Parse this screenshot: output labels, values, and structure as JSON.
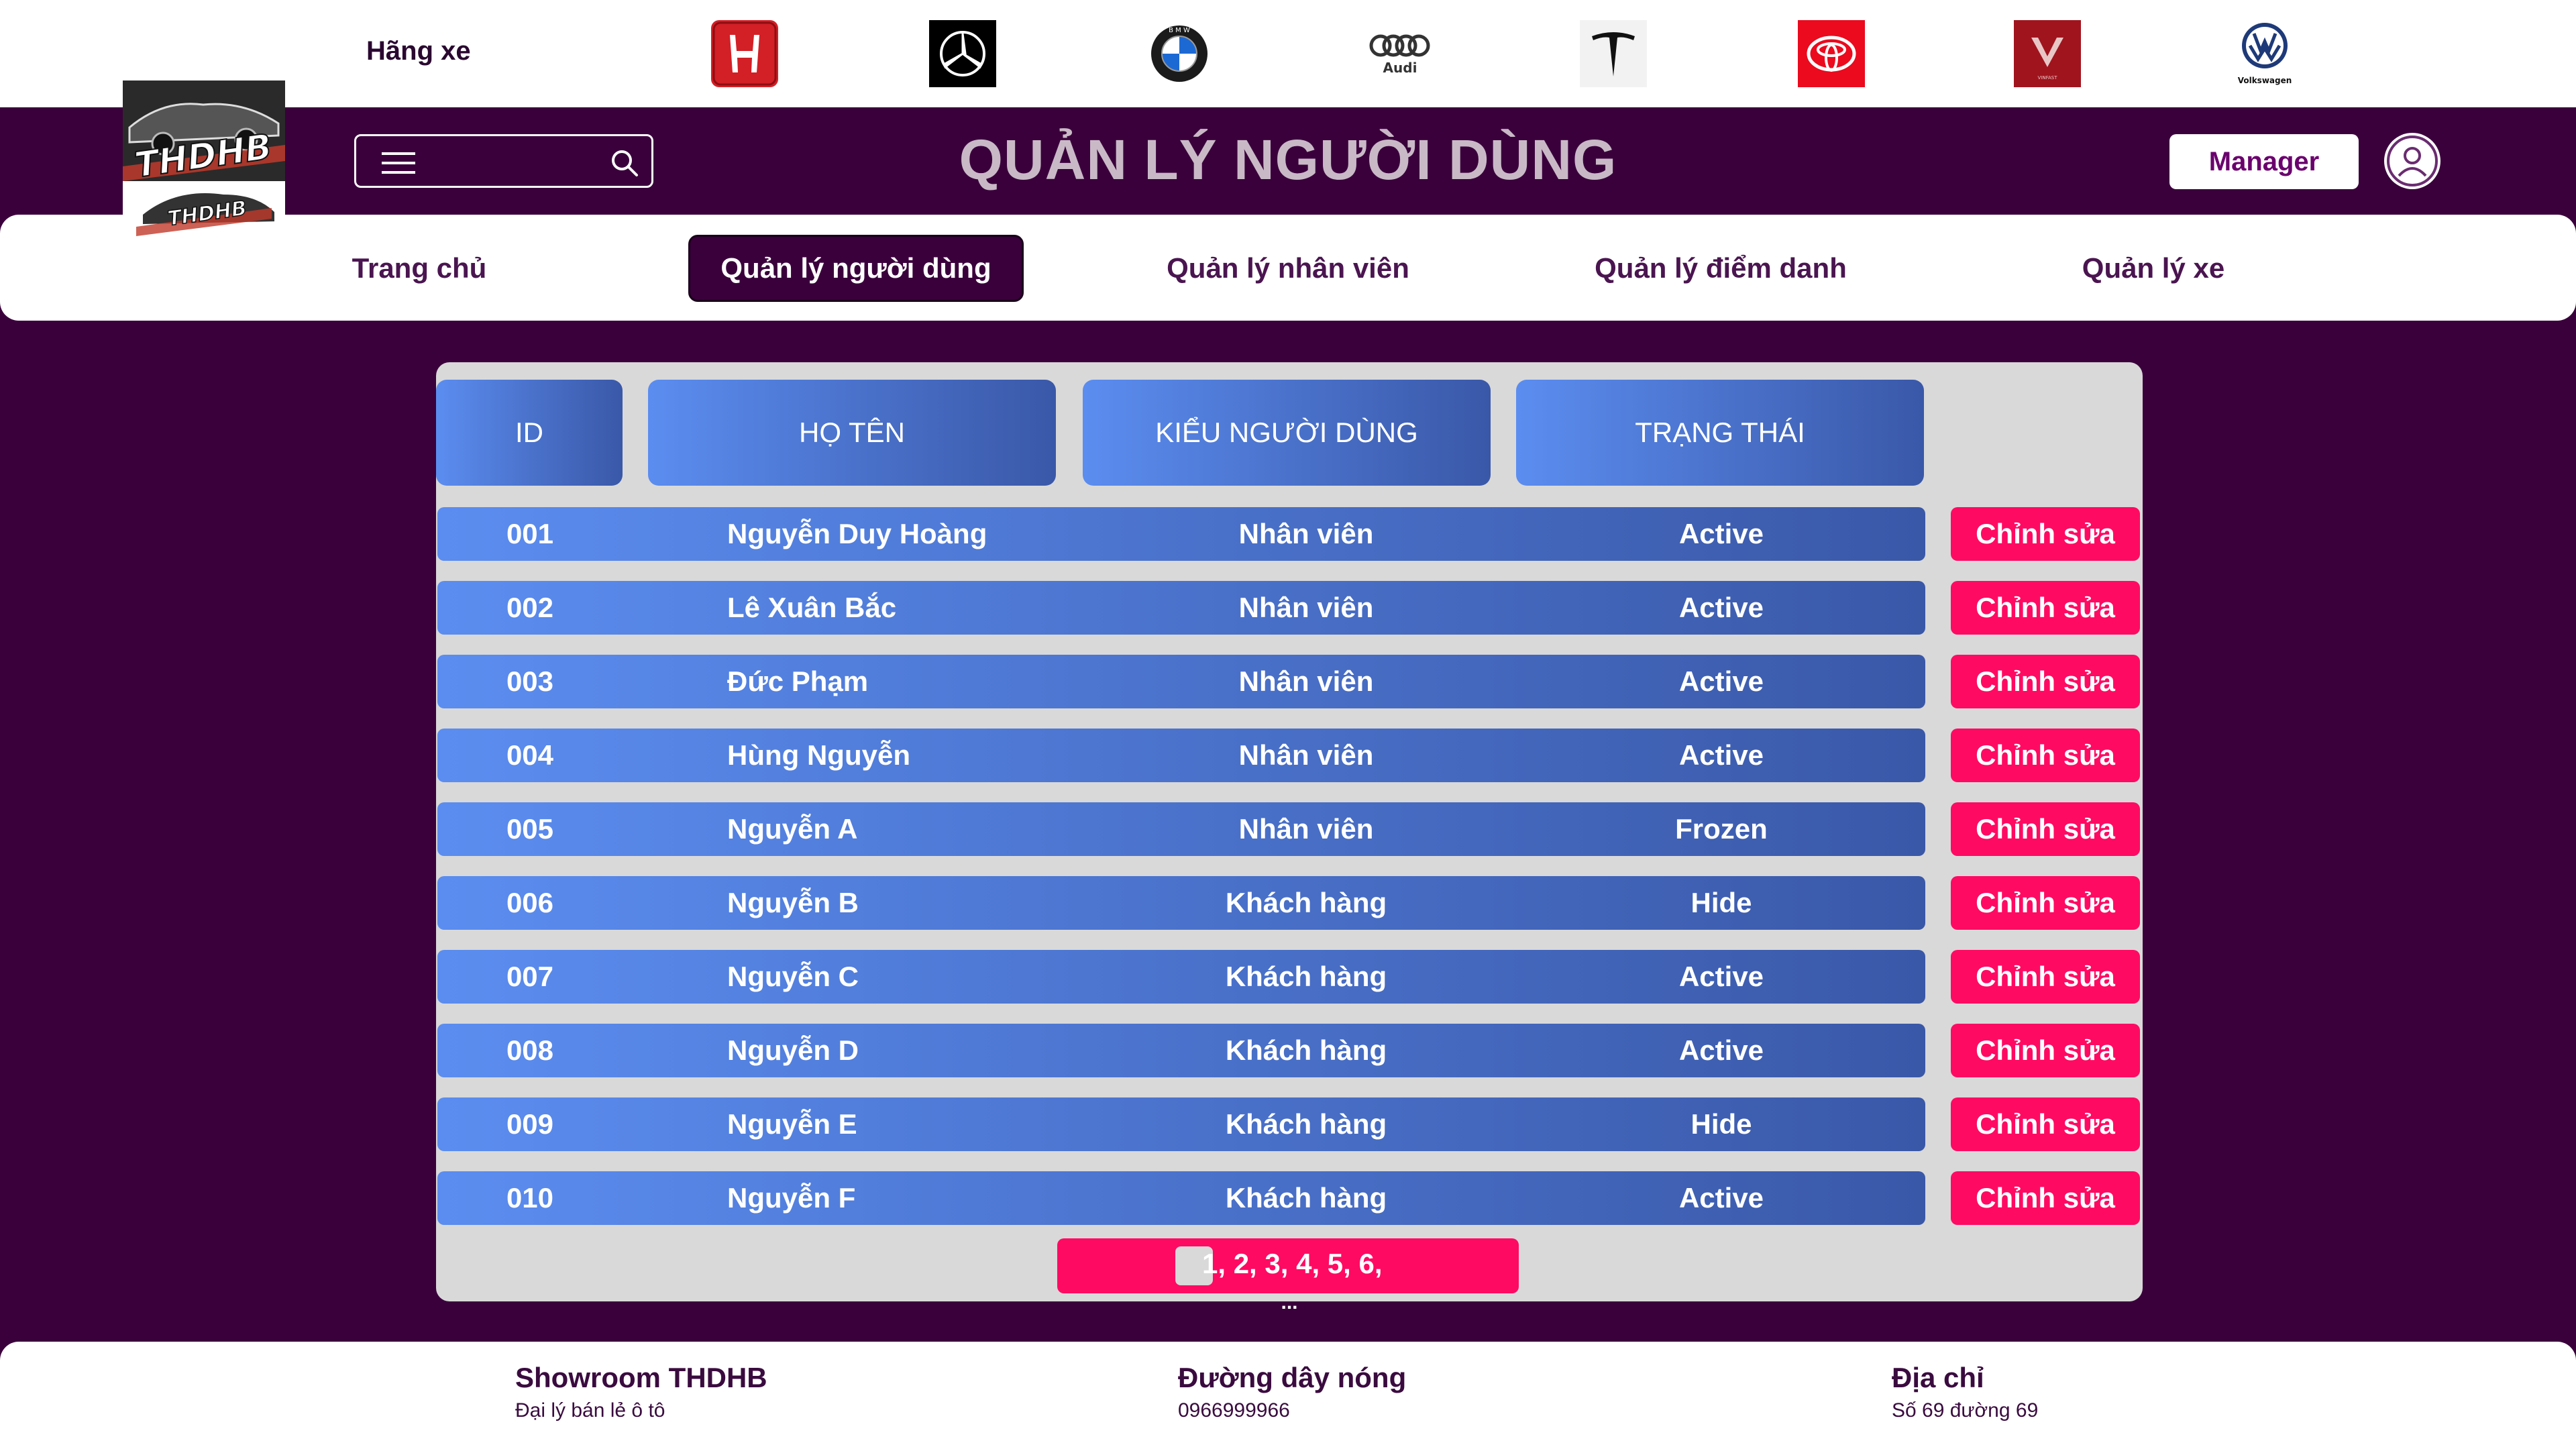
{
  "brands": {
    "label": "Hãng xe",
    "items": [
      {
        "name": "honda-logo",
        "color": "#d31f26"
      },
      {
        "name": "mercedes-logo",
        "color": "#000000"
      },
      {
        "name": "bmw-logo",
        "color": "#1c69d4"
      },
      {
        "name": "audi-logo",
        "color": "#000000",
        "text": "Audi"
      },
      {
        "name": "tesla-logo",
        "color": "#000000"
      },
      {
        "name": "toyota-logo",
        "color": "#eb0a1e"
      },
      {
        "name": "vinfast-logo",
        "color": "#b71c1c",
        "text": "VINFAST"
      },
      {
        "name": "volkswagen-logo",
        "color": "#1e3a78",
        "text": "Volkswagen"
      }
    ]
  },
  "logo": {
    "text": "THDHB"
  },
  "header": {
    "title": "QUẢN LÝ NGƯỜI DÙNG",
    "manager_label": "Manager"
  },
  "nav": {
    "items": [
      {
        "label": "Trang chủ",
        "active": false
      },
      {
        "label": "Quản lý người dùng",
        "active": true
      },
      {
        "label": "Quản lý nhân viên",
        "active": false
      },
      {
        "label": "Quản lý điểm danh",
        "active": false
      },
      {
        "label": "Quản lý xe",
        "active": false
      }
    ]
  },
  "table": {
    "headers": [
      "ID",
      "HỌ TÊN",
      "KIỂU NGƯỜI DÙNG",
      "TRẠNG THÁI"
    ],
    "edit_label": "Chỉnh sửa",
    "rows": [
      {
        "id": "001",
        "name": "Nguyễn Duy Hoàng",
        "type": "Nhân viên",
        "status": "Active"
      },
      {
        "id": "002",
        "name": "Lê Xuân Bắc",
        "type": "Nhân viên",
        "status": "Active"
      },
      {
        "id": "003",
        "name": "Đức Phạm",
        "type": "Nhân viên",
        "status": "Active"
      },
      {
        "id": "004",
        "name": "Hùng Nguyễn",
        "type": "Nhân viên",
        "status": "Active"
      },
      {
        "id": "005",
        "name": "Nguyễn A",
        "type": "Nhân viên",
        "status": "Frozen"
      },
      {
        "id": "006",
        "name": "Nguyễn B",
        "type": "Khách hàng",
        "status": "Hide"
      },
      {
        "id": "007",
        "name": "Nguyễn C",
        "type": "Khách hàng",
        "status": "Active"
      },
      {
        "id": "008",
        "name": "Nguyễn D",
        "type": "Khách hàng",
        "status": "Active"
      },
      {
        "id": "009",
        "name": "Nguyễn E",
        "type": "Khách hàng",
        "status": "Hide"
      },
      {
        "id": "010",
        "name": "Nguyễn F",
        "type": "Khách hàng",
        "status": "Active"
      }
    ]
  },
  "pagination": {
    "text": "1, 2, 3, 4, 5, 6,",
    "more": "...",
    "current": "1"
  },
  "footer": {
    "showroom_title": "Showroom THDHB",
    "showroom_sub": "Đại lý bán lẻ ô tô",
    "hotline_title": "Đường dây nóng",
    "hotline_value": "0966999966",
    "address_title": "Địa chỉ",
    "address_value": "Số 69 đường 69"
  },
  "colors": {
    "background": "#3a003b",
    "accent": "#ff0a63",
    "table_blue_start": "#5b8df0",
    "table_blue_end": "#3a58a8",
    "panel": "#d9d9d9"
  }
}
